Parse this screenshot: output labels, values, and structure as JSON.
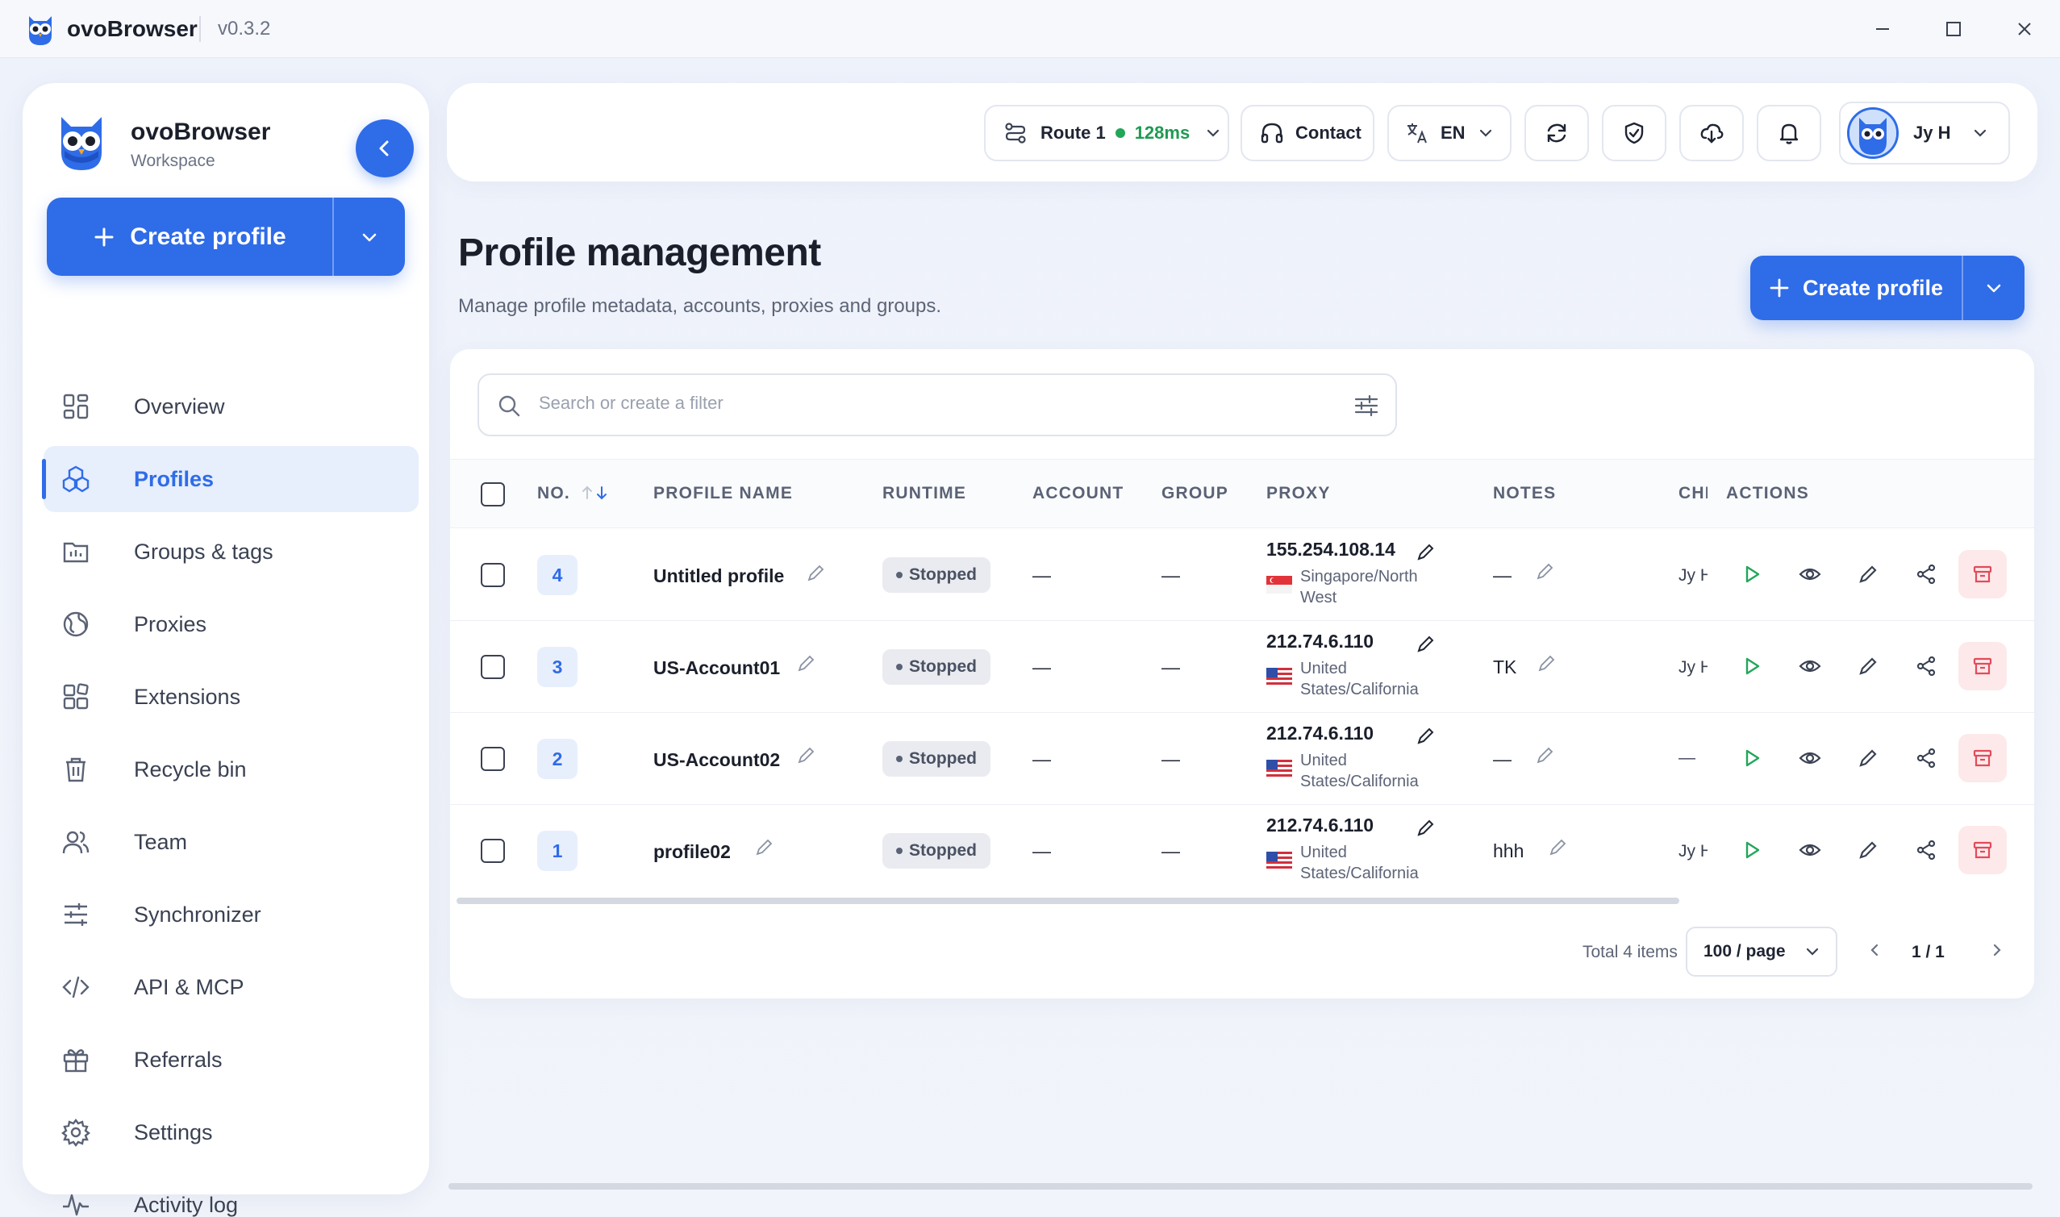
{
  "titlebar": {
    "app_name": "ovoBrowser",
    "version": "v0.3.2",
    "controls": [
      "minimize-icon",
      "maximize-icon",
      "close-icon"
    ]
  },
  "sidebar": {
    "brand": "ovoBrowser",
    "workspace": "Workspace",
    "create_label": "Create profile",
    "items": [
      {
        "label": "Overview",
        "icon": "grid-icon",
        "active": false
      },
      {
        "label": "Profiles",
        "icon": "cubes-icon",
        "active": true
      },
      {
        "label": "Groups & tags",
        "icon": "folder-icon",
        "active": false
      },
      {
        "label": "Proxies",
        "icon": "globe-icon",
        "active": false
      },
      {
        "label": "Extensions",
        "icon": "puzzle-icon",
        "active": false
      },
      {
        "label": "Recycle bin",
        "icon": "trash-icon",
        "active": false
      },
      {
        "label": "Team",
        "icon": "users-icon",
        "active": false
      },
      {
        "label": "Synchronizer",
        "icon": "sliders-icon",
        "active": false
      },
      {
        "label": "API & MCP",
        "icon": "code-icon",
        "active": false
      },
      {
        "label": "Referrals",
        "icon": "gift-icon",
        "active": false
      },
      {
        "label": "Settings",
        "icon": "gear-icon",
        "active": false
      },
      {
        "label": "Activity log",
        "icon": "activity-icon",
        "active": false
      }
    ]
  },
  "topbar": {
    "route_label": "Route 1",
    "latency": "128ms",
    "contact_label": "Contact",
    "language": "EN",
    "user_name": "Jy H"
  },
  "page": {
    "title": "Profile management",
    "subtitle": "Manage profile metadata, accounts, proxies and groups.",
    "create_label": "Create profile"
  },
  "search": {
    "placeholder": "Search or create a filter",
    "value": ""
  },
  "table": {
    "columns": {
      "no": "NO.",
      "profile_name": "PROFILE NAME",
      "runtime": "RUNTIME",
      "account": "ACCOUNT",
      "group": "GROUP",
      "proxy": "PROXY",
      "notes": "NOTES",
      "creator": "CHI",
      "actions": "ACTIONS"
    },
    "rows": [
      {
        "no": "4",
        "name": "Untitled profile",
        "runtime": "Stopped",
        "account": "—",
        "group": "—",
        "proxy_ip": "155.254.108.14",
        "proxy_loc_1": "Singapore/North",
        "proxy_loc_2": "West",
        "flag": "sg",
        "notes": "—",
        "creator": "Jy H"
      },
      {
        "no": "3",
        "name": "US-Account01",
        "runtime": "Stopped",
        "account": "—",
        "group": "—",
        "proxy_ip": "212.74.6.110",
        "proxy_loc_1": "United",
        "proxy_loc_2": "States/California",
        "flag": "us",
        "notes": "TK",
        "creator": "Jy H"
      },
      {
        "no": "2",
        "name": "US-Account02",
        "runtime": "Stopped",
        "account": "—",
        "group": "—",
        "proxy_ip": "212.74.6.110",
        "proxy_loc_1": "United",
        "proxy_loc_2": "States/California",
        "flag": "us",
        "notes": "—",
        "creator": "—"
      },
      {
        "no": "1",
        "name": "profile02",
        "runtime": "Stopped",
        "account": "—",
        "group": "—",
        "proxy_ip": "212.74.6.110",
        "proxy_loc_1": "United",
        "proxy_loc_2": "States/California",
        "flag": "us",
        "notes": "hhh",
        "creator": "Jy H"
      }
    ]
  },
  "footer": {
    "total": "Total 4 items",
    "per_page": "100 / page",
    "page_indicator": "1 / 1"
  },
  "colors": {
    "accent": "#2f6ce8",
    "play": "#22a65a",
    "danger": "#e24b5a"
  }
}
